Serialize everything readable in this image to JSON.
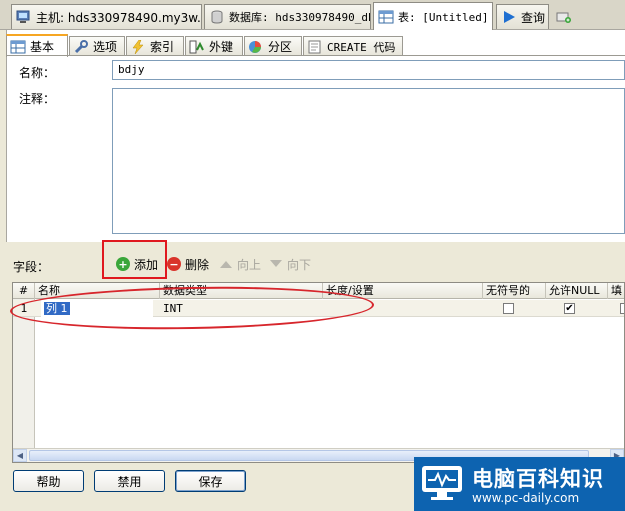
{
  "doc_tabs": [
    {
      "label": "主机: hds330978490.my3w.c···",
      "icon": "host-icon"
    },
    {
      "label": "数据库: hds330978490_db",
      "icon": "database-icon"
    },
    {
      "label": "表: [Untitled]",
      "icon": "table-icon"
    },
    {
      "label": "查询",
      "icon": "query-run-icon"
    }
  ],
  "sub_tabs": [
    {
      "label": "基本",
      "icon": "table-grid-icon"
    },
    {
      "label": "选项",
      "icon": "wrench-icon"
    },
    {
      "label": "索引",
      "icon": "lightning-icon"
    },
    {
      "label": "外键",
      "icon": "foreign-key-icon"
    },
    {
      "label": "分区",
      "icon": "partition-pie-icon"
    },
    {
      "label": "CREATE 代码",
      "icon": "code-icon"
    }
  ],
  "basic": {
    "name_label": "名称：",
    "name_value": "bdjy",
    "comment_label": "注释："
  },
  "fields": {
    "label": "字段：",
    "add": "添加",
    "delete": "删除",
    "up": "向上",
    "down": "向下"
  },
  "grid": {
    "headers": [
      "#",
      "名称",
      "数据类型",
      "长度/设置",
      "无符号的",
      "允许NULL",
      "填"
    ],
    "rows": [
      {
        "num": "1",
        "name": "列 1",
        "type": "INT",
        "length": "",
        "unsigned": false,
        "allow_null": true
      }
    ]
  },
  "buttons": {
    "help": "帮助",
    "disable": "禁用",
    "save": "保存"
  },
  "watermark": {
    "title": "电脑百科知识",
    "url": "www.pc-daily.com"
  },
  "colors": {
    "highlight_red": "#e0181f",
    "selection_blue": "#316ac5",
    "watermark_blue": "#0d63b0"
  }
}
